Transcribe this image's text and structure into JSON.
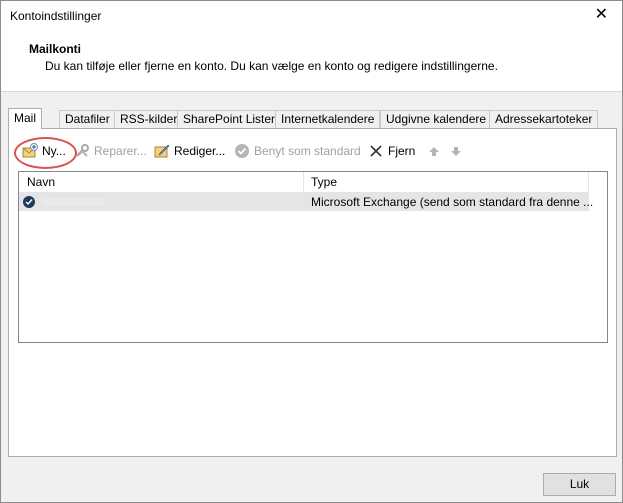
{
  "window": {
    "title": "Kontoindstillinger",
    "close_glyph": "✕"
  },
  "header": {
    "title": "Mailkonti",
    "description": "Du kan tilføje eller fjerne en konto. Du kan vælge en konto og redigere indstillingerne."
  },
  "tabs": [
    {
      "label": "Mail",
      "active": true
    },
    {
      "label": "Datafiler"
    },
    {
      "label": "RSS-kilder"
    },
    {
      "label": "SharePoint Lister"
    },
    {
      "label": "Internetkalendere"
    },
    {
      "label": "Udgivne kalendere"
    },
    {
      "label": "Adressekartoteker"
    }
  ],
  "toolbar": {
    "new_label": "Ny...",
    "repair_label": "Reparer...",
    "edit_label": "Rediger...",
    "default_label": "Benyt som standard",
    "remove_label": "Fjern",
    "icons": [
      "new-account-icon",
      "repair-icon",
      "edit-icon",
      "check-circle-icon",
      "x-remove-icon",
      "arrow-up-icon",
      "arrow-down-icon"
    ]
  },
  "list": {
    "columns": {
      "name": "Navn",
      "type": "Type"
    },
    "rows": [
      {
        "name": "",
        "type": "Microsoft Exchange (send som standard fra denne ..."
      }
    ]
  },
  "footer": {
    "close_label": "Luk"
  },
  "colors": {
    "highlight": "#d9534f",
    "default_badge": "#1f3a5f"
  }
}
